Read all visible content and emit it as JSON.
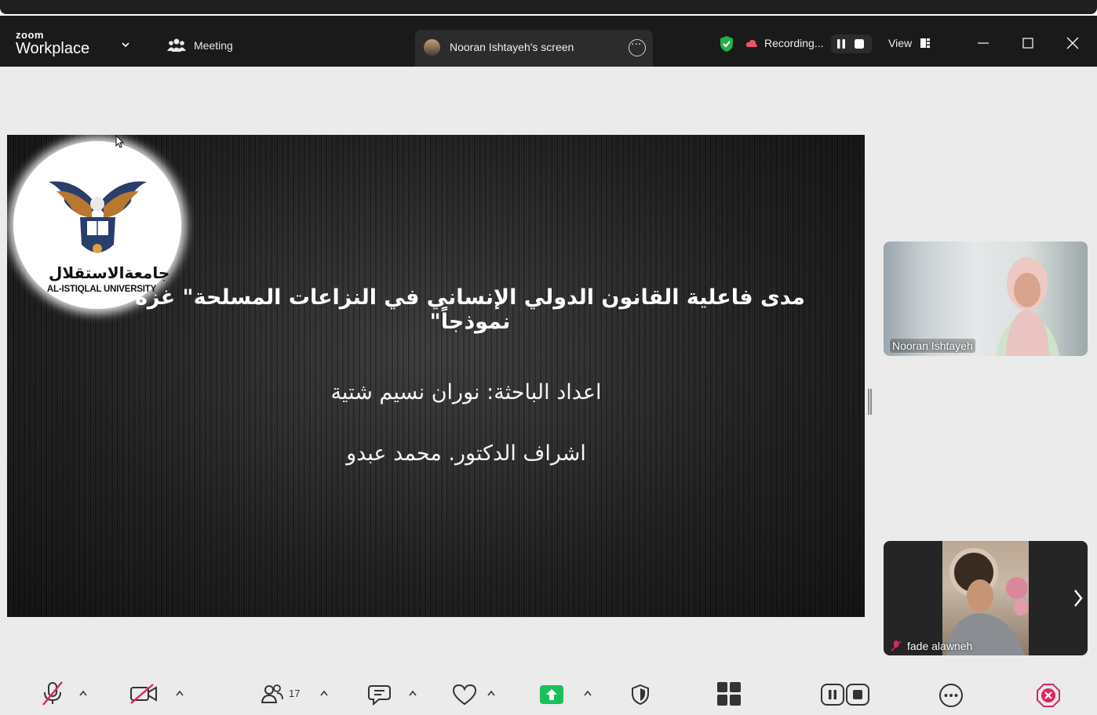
{
  "app": {
    "brand_small": "zoom",
    "brand_big": "Workplace",
    "meeting_label": "Meeting",
    "tab_title": "Nooran Ishtayeh's screen",
    "recording_label": "Recording...",
    "view_label": "View"
  },
  "slide": {
    "logo_arabic": "جامعةالاستقلال",
    "logo_english": "AL-ISTIQLAL UNIVERSITY",
    "title": "مدى فاعلية القانون الدولي الإنساني في النزاعات المسلحة\" غزة نموذجاً\"",
    "author": "اعداد الباحثة: نوران نسيم شتية",
    "supervisor": "اشراف الدكتور. محمد عبدو"
  },
  "participants": [
    {
      "name": "Nooran Ishtayeh"
    },
    {
      "name": "fade alawneh"
    }
  ],
  "toolbar": {
    "participants_count": "17"
  },
  "colors": {
    "titlebar": "#1a1a1a",
    "share_green": "#19c15a",
    "end_red": "#e0245e",
    "shield_green": "#22b14c"
  }
}
